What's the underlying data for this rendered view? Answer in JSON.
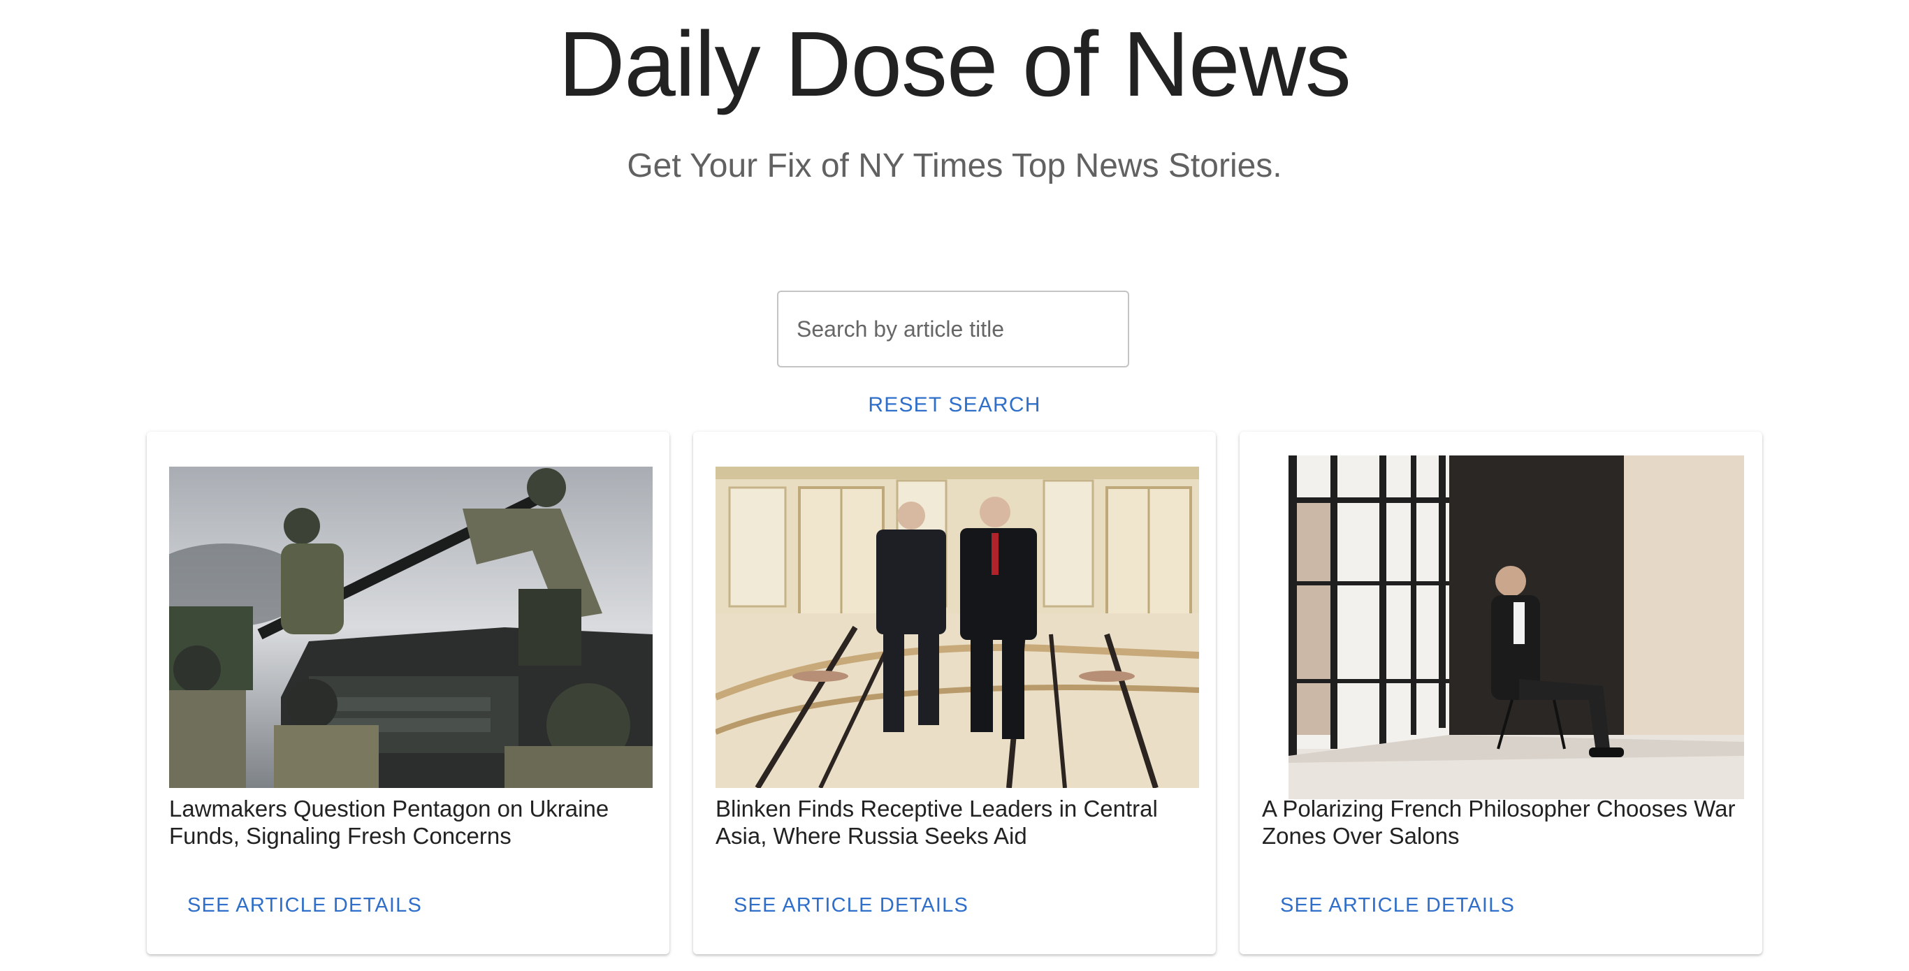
{
  "header": {
    "title": "Daily Dose of News",
    "subtitle": "Get Your Fix of NY Times Top News Stories."
  },
  "search": {
    "placeholder": "Search by article title",
    "value": "",
    "reset_label": "RESET SEARCH"
  },
  "articles": [
    {
      "title": "Lawmakers Question Pentagon on Ukraine Funds, Signaling Fresh Concerns",
      "button_label": "SEE ARTICLE DETAILS",
      "image": "photo-soldiers-loading-weapon"
    },
    {
      "title": "Blinken Finds Receptive Leaders in Central Asia, Where Russia Seeks Aid",
      "button_label": "SEE ARTICLE DETAILS",
      "image": "photo-officials-walking-hall"
    },
    {
      "title": "A Polarizing French Philosopher Chooses War Zones Over Salons",
      "button_label": "SEE ARTICLE DETAILS",
      "image": "photo-man-seated-by-window"
    }
  ],
  "colors": {
    "accent": "#2f6fc9",
    "title_text": "#222222",
    "subtitle_text": "#616161",
    "card_background": "#ffffff"
  }
}
